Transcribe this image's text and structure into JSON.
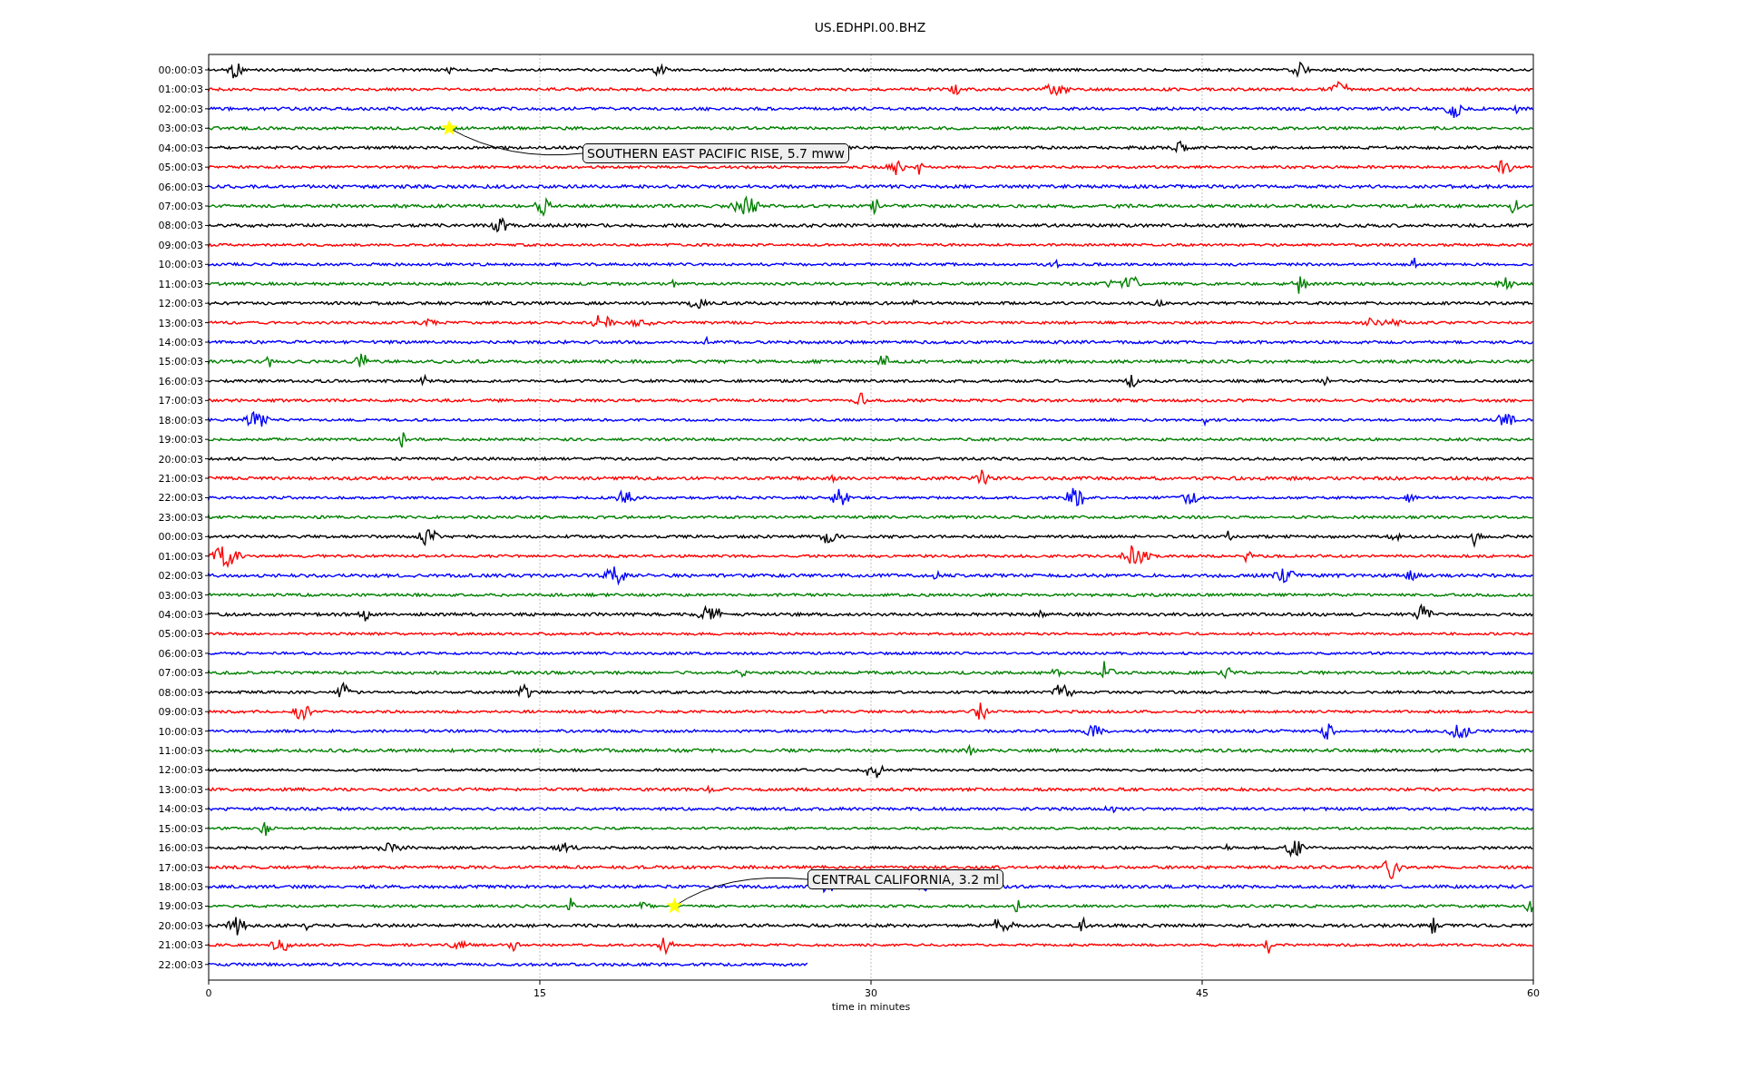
{
  "title": "US.EDHPI.00.BHZ",
  "plot": {
    "xlabel": "time in minutes",
    "x_ticks": [
      "0",
      "15",
      "30",
      "45",
      "60"
    ],
    "rows": [
      {
        "label": "00:00:03",
        "color": "#000000",
        "level": 1
      },
      {
        "label": "01:00:03",
        "color": "#ff0000",
        "level": 1
      },
      {
        "label": "02:00:03",
        "color": "#0000ff",
        "level": 1
      },
      {
        "label": "03:00:03",
        "color": "#008000",
        "level": 1,
        "event": {
          "label": "SOUTHERN EAST PACIFIC RISE, 5.7 mww"
        }
      },
      {
        "label": "04:00:03",
        "color": "#000000",
        "level": 1
      },
      {
        "label": "05:00:03",
        "color": "#ff0000",
        "level": 1
      },
      {
        "label": "06:00:03",
        "color": "#0000ff",
        "level": 1
      },
      {
        "label": "07:00:03",
        "color": "#008000",
        "level": 1
      },
      {
        "label": "08:00:03",
        "color": "#000000",
        "level": 1
      },
      {
        "label": "09:00:03",
        "color": "#ff0000",
        "level": 1
      },
      {
        "label": "10:00:03",
        "color": "#0000ff",
        "level": 1
      },
      {
        "label": "11:00:03",
        "color": "#008000",
        "level": 1
      },
      {
        "label": "12:00:03",
        "color": "#000000",
        "level": 1
      },
      {
        "label": "13:00:03",
        "color": "#ff0000",
        "level": 1
      },
      {
        "label": "14:00:03",
        "color": "#0000ff",
        "level": 1
      },
      {
        "label": "15:00:03",
        "color": "#008000",
        "level": 1
      },
      {
        "label": "16:00:03",
        "color": "#000000",
        "level": 1
      },
      {
        "label": "17:00:03",
        "color": "#ff0000",
        "level": 1
      },
      {
        "label": "18:00:03",
        "color": "#0000ff",
        "level": 1
      },
      {
        "label": "19:00:03",
        "color": "#008000",
        "level": 1
      },
      {
        "label": "20:00:03",
        "color": "#000000",
        "level": 1
      },
      {
        "label": "21:00:03",
        "color": "#ff0000",
        "level": 1
      },
      {
        "label": "22:00:03",
        "color": "#0000ff",
        "level": 1
      },
      {
        "label": "23:00:03",
        "color": "#008000",
        "level": 1
      },
      {
        "label": "00:00:03",
        "color": "#000000",
        "level": 1
      },
      {
        "label": "01:00:03",
        "color": "#ff0000",
        "level": 1
      },
      {
        "label": "02:00:03",
        "color": "#0000ff",
        "level": 1
      },
      {
        "label": "03:00:03",
        "color": "#008000",
        "level": 1
      },
      {
        "label": "04:00:03",
        "color": "#000000",
        "level": 1
      },
      {
        "label": "05:00:03",
        "color": "#ff0000",
        "level": 1
      },
      {
        "label": "06:00:03",
        "color": "#0000ff",
        "level": 1
      },
      {
        "label": "07:00:03",
        "color": "#008000",
        "level": 1
      },
      {
        "label": "08:00:03",
        "color": "#000000",
        "level": 1
      },
      {
        "label": "09:00:03",
        "color": "#ff0000",
        "level": 1
      },
      {
        "label": "10:00:03",
        "color": "#0000ff",
        "level": 1
      },
      {
        "label": "11:00:03",
        "color": "#008000",
        "level": 1
      },
      {
        "label": "12:00:03",
        "color": "#000000",
        "level": 1
      },
      {
        "label": "13:00:03",
        "color": "#ff0000",
        "level": 1
      },
      {
        "label": "14:00:03",
        "color": "#0000ff",
        "level": 1
      },
      {
        "label": "15:00:03",
        "color": "#008000",
        "level": 1
      },
      {
        "label": "16:00:03",
        "color": "#000000",
        "level": 1
      },
      {
        "label": "17:00:03",
        "color": "#ff0000",
        "level": 1
      },
      {
        "label": "18:00:03",
        "color": "#0000ff",
        "level": 1
      },
      {
        "label": "19:00:03",
        "color": "#008000",
        "level": 1,
        "event": {
          "label": "CENTRAL CALIFORNIA, 3.2 ml"
        }
      },
      {
        "label": "20:00:03",
        "color": "#000000",
        "level": 1
      },
      {
        "label": "21:00:03",
        "color": "#ff0000",
        "level": 1
      },
      {
        "label": "22:00:03",
        "color": "#0000ff",
        "level": 0.453
      }
    ]
  }
}
